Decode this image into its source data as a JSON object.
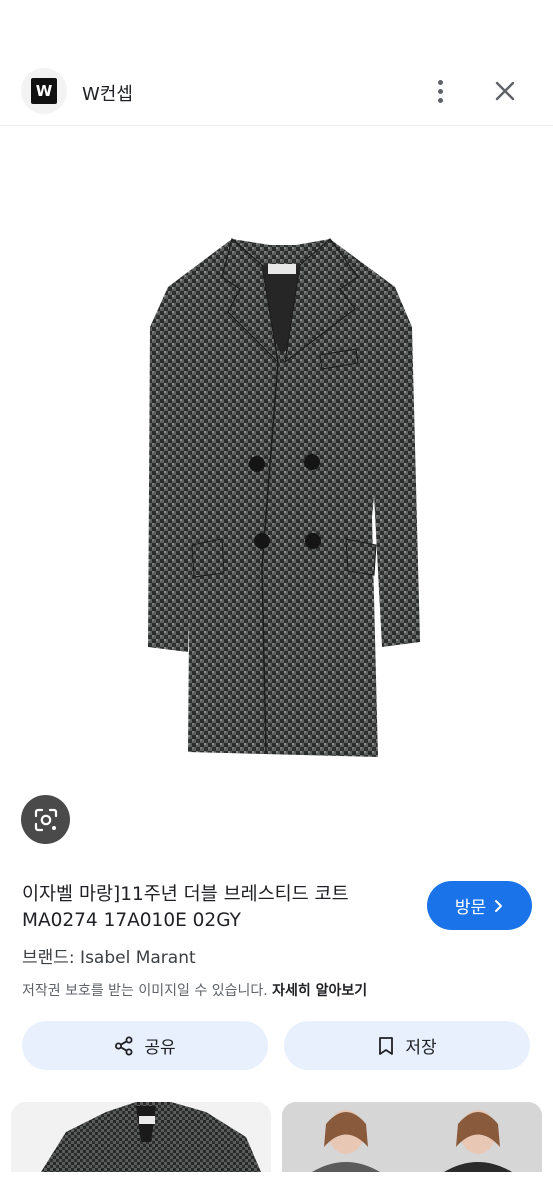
{
  "header": {
    "logo_letter": "W",
    "site_name": "W컨셉"
  },
  "result": {
    "title_line1": "이자벨 마랑]11주년 더블 브레스티드 코트",
    "title_line2": "MA0274 17A010E 02GY",
    "brand": "브랜드: Isabel Marant",
    "copyright_text": "저작권 보호를 받는 이미지일 수 있습니다.",
    "learn_more": "자세히 알아보기",
    "visit_label": "방문"
  },
  "actions": {
    "share_label": "공유",
    "save_label": "저장"
  },
  "colors": {
    "accent": "#1a73e8",
    "action_bg": "#e8f0fe"
  }
}
